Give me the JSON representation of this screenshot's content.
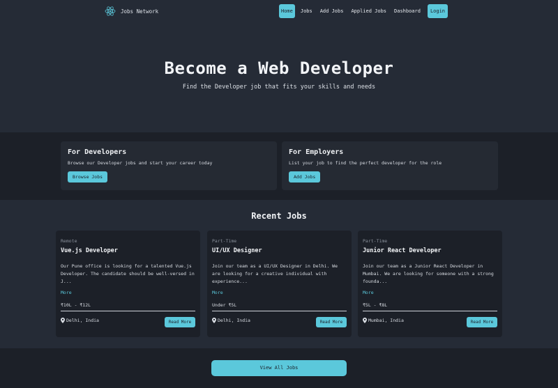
{
  "nav": {
    "brand": "Jobs Network",
    "links": [
      {
        "label": "Home",
        "active": true
      },
      {
        "label": "Jobs"
      },
      {
        "label": "Add Jobs"
      },
      {
        "label": "Applied Jobs"
      },
      {
        "label": "Dashboard"
      }
    ],
    "login": "Login"
  },
  "hero": {
    "title": "Become a Web Developer",
    "subtitle": "Find the Developer job that fits your skills and needs"
  },
  "audiences": [
    {
      "title": "For Developers",
      "text": "Browse our Developer jobs and start your career today",
      "button": "Browse Jobs"
    },
    {
      "title": "For Employers",
      "text": "List your job to find the perfect developer for the role",
      "button": "Add Jobs"
    }
  ],
  "recent": {
    "heading": "Recent Jobs",
    "jobs": [
      {
        "type": "Remote",
        "title": "Vue.js Developer",
        "description": "Our Pune office is looking for a talented Vue.js Developer. The candidate should be well-versed in J...",
        "more": "More",
        "salary": "₹10L - ₹12L",
        "location": "Delhi, India",
        "button": "Read More"
      },
      {
        "type": "Part-Time",
        "title": "UI/UX Designer",
        "description": "Join our team as a UI/UX Designer in Delhi. We are looking for a creative individual with experience...",
        "more": "More",
        "salary": "Under ₹5L",
        "location": "Delhi, India",
        "button": "Read More"
      },
      {
        "type": "Part-Time",
        "title": "Junior React Developer",
        "description": "Join our team as a Junior React Developer in Mumbai. We are looking for someone with a strong founda...",
        "more": "More",
        "salary": "₹5L - ₹8L",
        "location": "Mumbai, India",
        "button": "Read More"
      }
    ]
  },
  "footer": {
    "view_all": "View All Jobs"
  },
  "colors": {
    "accent": "#5bc8db",
    "background": "#252b36",
    "band": "#1c2028"
  }
}
